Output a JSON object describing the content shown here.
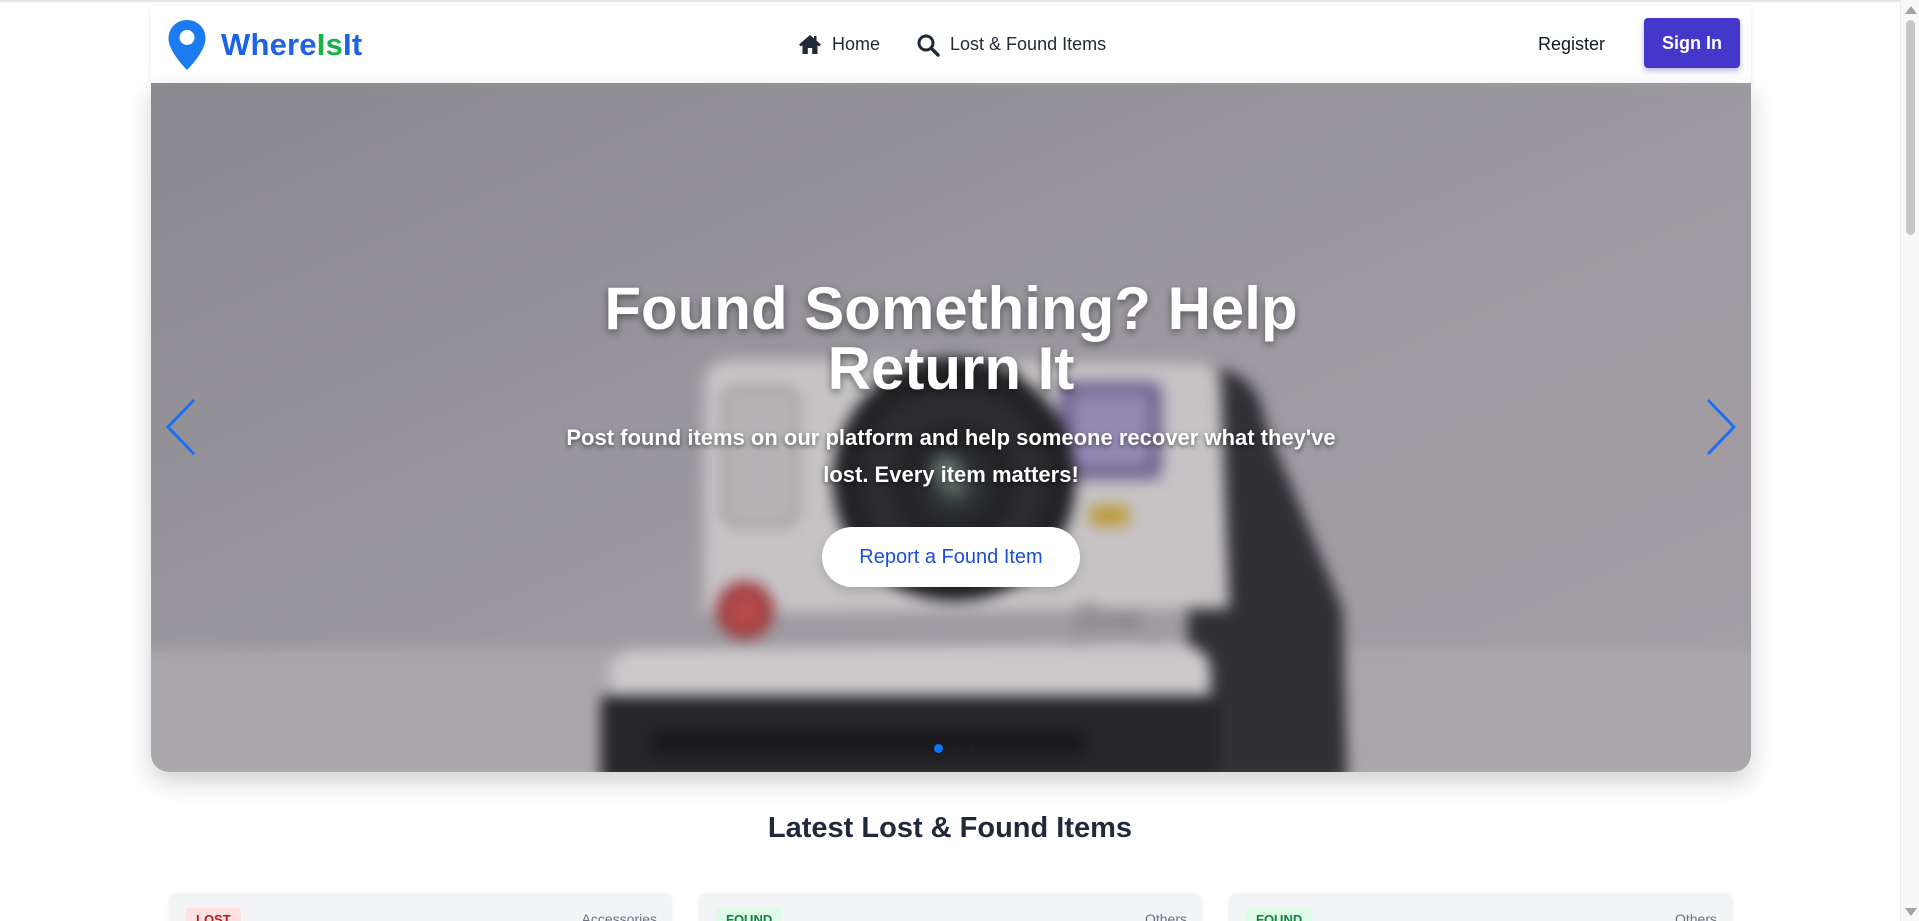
{
  "brand": {
    "name_part1": "Where",
    "name_part2": "Is",
    "name_part3": "It",
    "icon": "map-pin-icon",
    "color_primary": "#1d63e8",
    "color_accent": "#16b34a"
  },
  "nav": {
    "links": [
      {
        "label": "Home",
        "icon": "home-icon"
      },
      {
        "label": "Lost & Found Items",
        "icon": "search-icon"
      }
    ],
    "register_label": "Register",
    "signin_label": "Sign In",
    "signin_color": "#4338ca"
  },
  "hero": {
    "title": "Found Something? Help Return It",
    "subtitle": "Post found items on our platform and help someone recover what they've lost. Every item matters!",
    "cta_label": "Report a Found Item",
    "active_slide": 1,
    "slide_count": 3,
    "image_subject": "instant camera"
  },
  "latest": {
    "title": "Latest Lost & Found Items",
    "cards": [
      {
        "status": "LOST",
        "category": "Accessories"
      },
      {
        "status": "FOUND",
        "category": "Others"
      },
      {
        "status": "FOUND",
        "category": "Others"
      }
    ]
  }
}
